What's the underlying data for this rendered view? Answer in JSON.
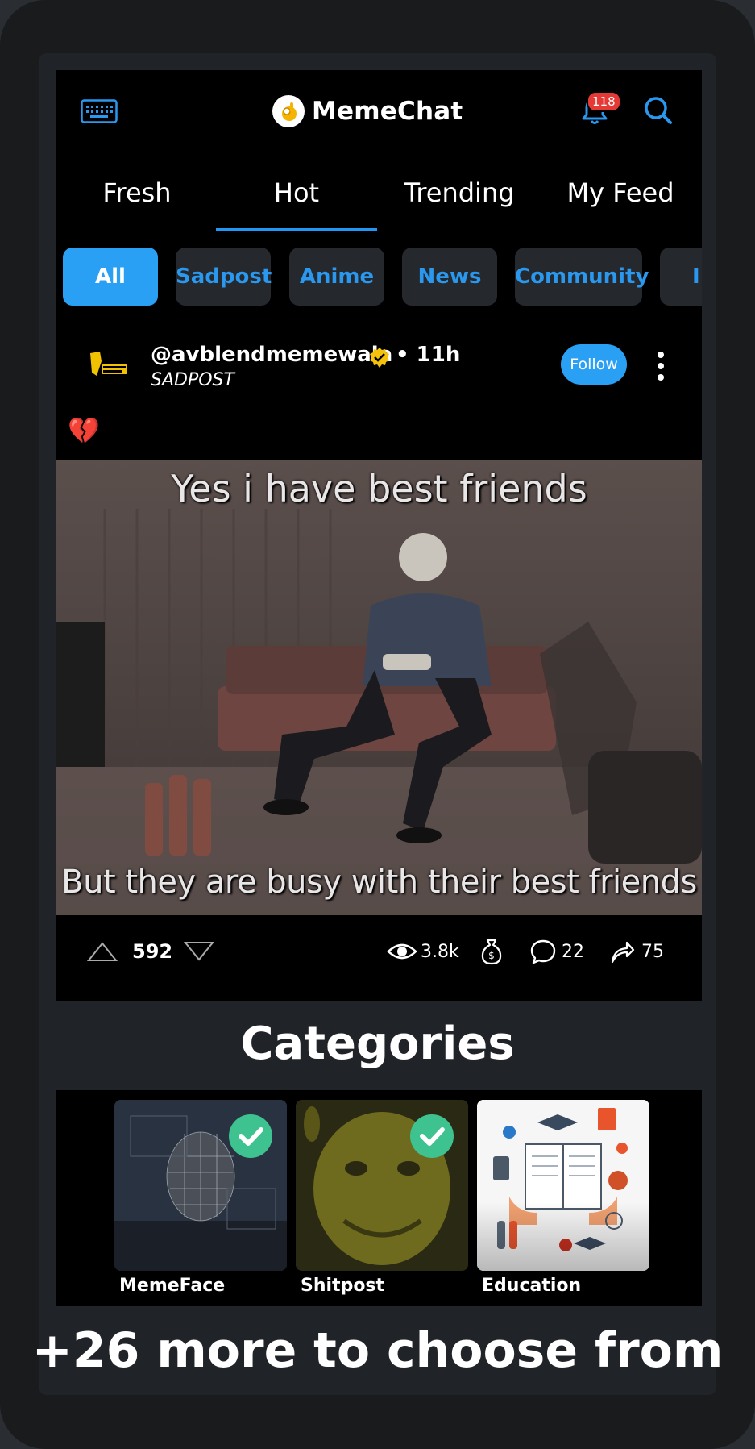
{
  "header": {
    "app_name": "MemeChat",
    "notification_count": "118",
    "icons": [
      "keyboard-icon",
      "meme-logo-icon",
      "bell-icon",
      "search-icon"
    ]
  },
  "tabs": [
    {
      "label": "Fresh"
    },
    {
      "label": "Hot",
      "active": true
    },
    {
      "label": "Trending"
    },
    {
      "label": "My Feed"
    }
  ],
  "chips": [
    {
      "label": "All",
      "active": true
    },
    {
      "label": "Sadpost"
    },
    {
      "label": "Anime"
    },
    {
      "label": "News"
    },
    {
      "label": "Community"
    },
    {
      "label": "II"
    }
  ],
  "post": {
    "username": "@avblendmemewala",
    "time": "• 11h",
    "category": "SADPOST",
    "follow_label": "Follow",
    "caption_emoji": "💔",
    "meme_top_text": "Yes i have best friends",
    "meme_bottom_text": "But they are busy with their best friends",
    "votes": "592",
    "views": "3.8k",
    "comments": "22",
    "shares": "75"
  },
  "categories": {
    "title": "Categories",
    "items": [
      {
        "label": "MemeFace",
        "selected": true
      },
      {
        "label": "Shitpost",
        "selected": true
      },
      {
        "label": "Education",
        "selected": false
      }
    ],
    "more_text": "+26 more to choose from"
  },
  "colors": {
    "accent": "#2aa0f5",
    "tab_underline": "#2196f3",
    "badge": "#e53935",
    "check": "#3ec28f"
  }
}
